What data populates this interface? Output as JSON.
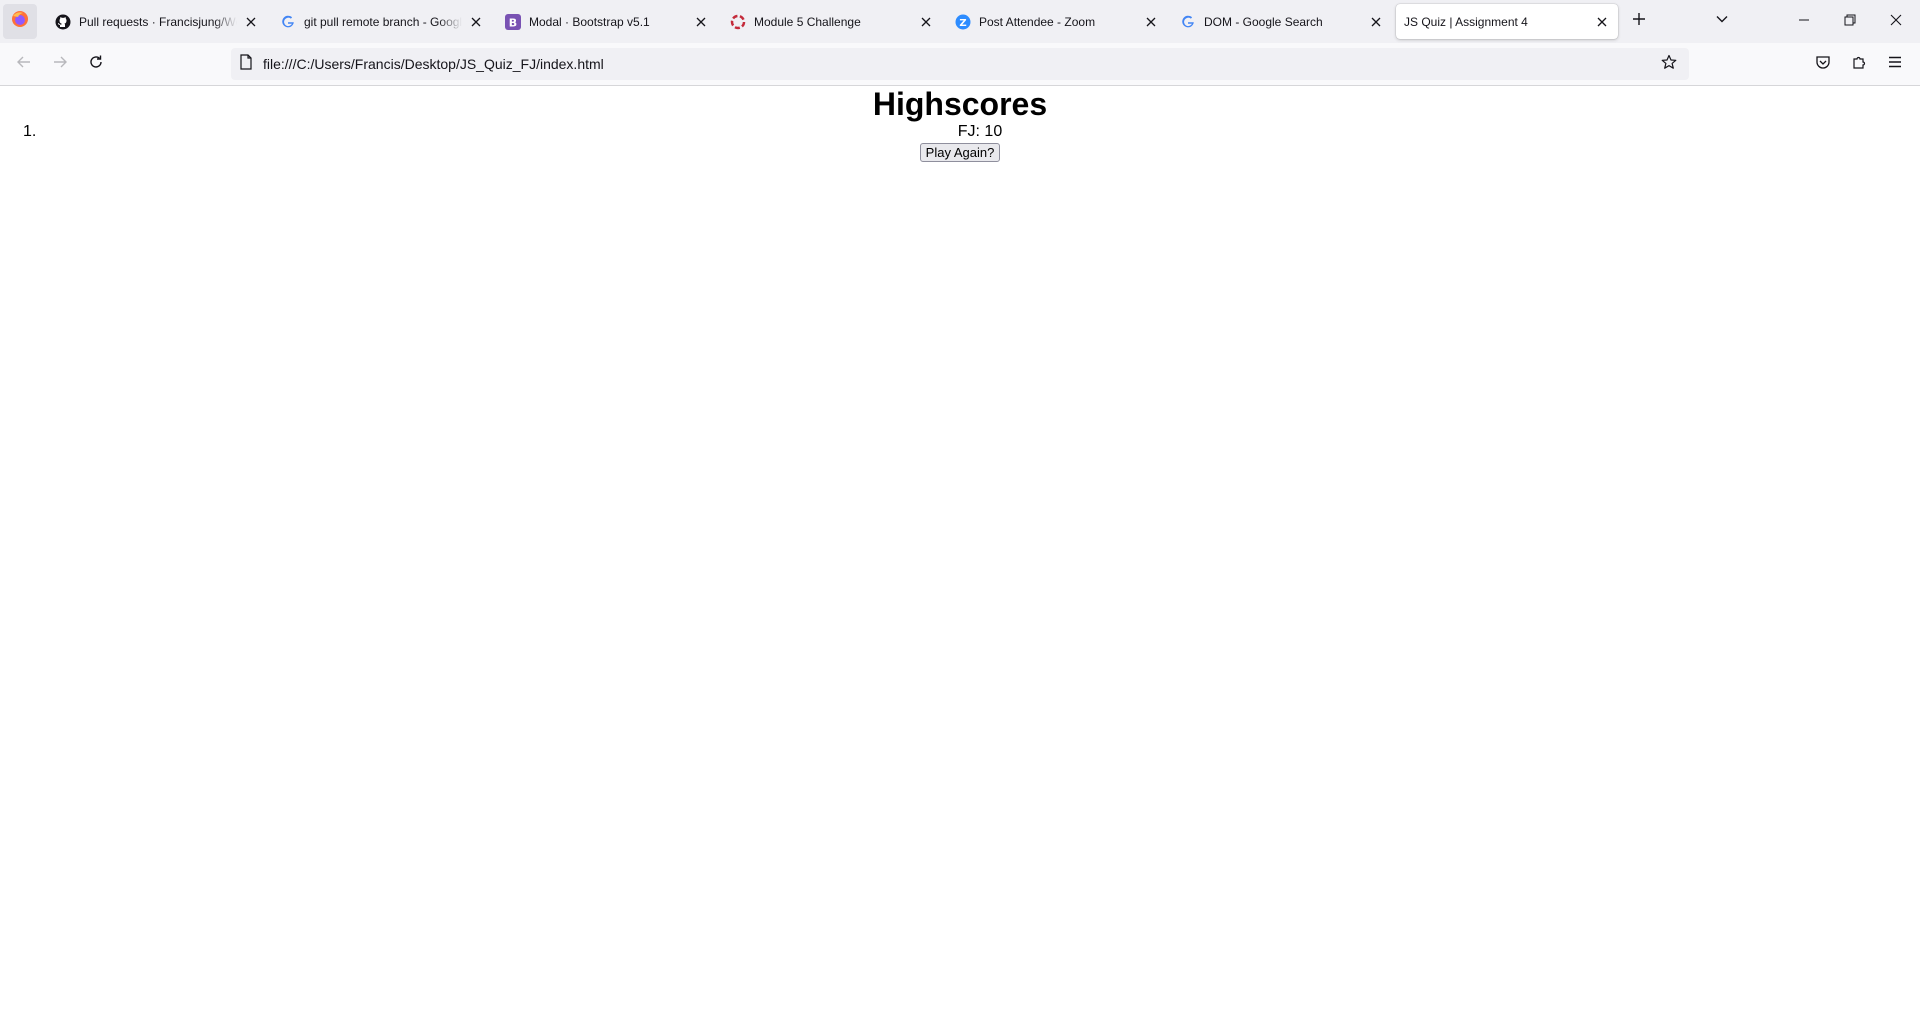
{
  "browser": {
    "tabs": [
      {
        "title": "Pull requests · Francisjung/Week",
        "favicon": "github-icon",
        "active": false
      },
      {
        "title": "git pull remote branch - Google Search",
        "favicon": "google-icon",
        "active": false
      },
      {
        "title": "Modal · Bootstrap v5.1",
        "favicon": "bootstrap-icon",
        "active": false
      },
      {
        "title": "Module 5 Challenge",
        "favicon": "canvas-icon",
        "active": false
      },
      {
        "title": "Post Attendee - Zoom",
        "favicon": "zoom-icon",
        "active": false
      },
      {
        "title": "DOM - Google Search",
        "favicon": "google-icon",
        "active": false
      },
      {
        "title": "JS Quiz | Assignment 4",
        "favicon": "none",
        "active": true
      }
    ],
    "url": "file:///C:/Users/Francis/Desktop/JS_Quiz_FJ/index.html"
  },
  "page": {
    "heading": "Highscores",
    "list_number": "1.",
    "scores": [
      "FJ: 10"
    ],
    "play_again_label": "Play Again?"
  },
  "colors": {
    "tabstrip_bg": "#f0f0f4",
    "navbar_bg": "#f9f9fb",
    "bootstrap_purple": "#7952b3",
    "zoom_blue": "#2d8cff"
  }
}
